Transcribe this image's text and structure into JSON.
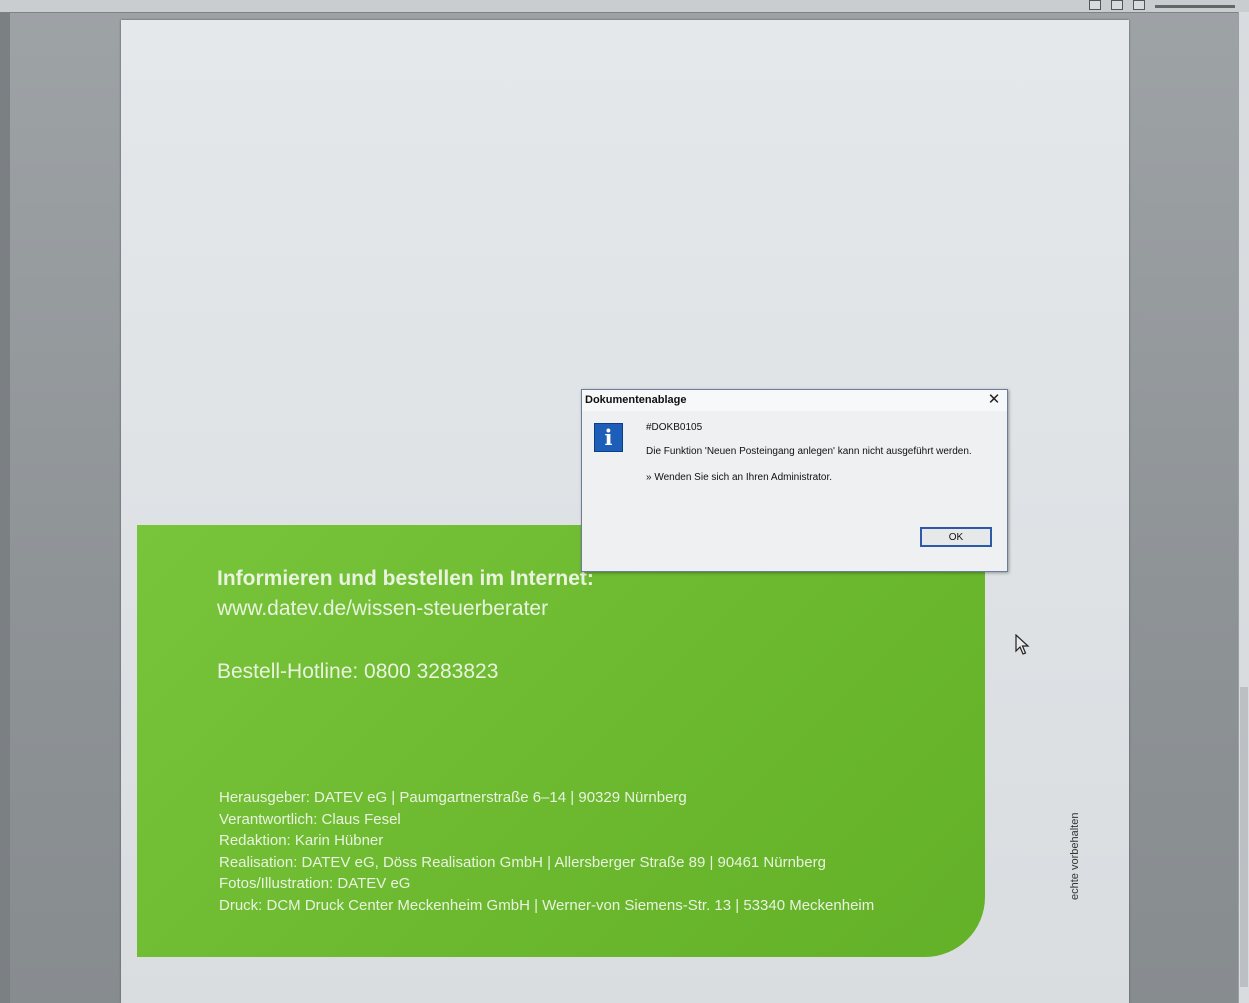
{
  "document": {
    "green_panel": {
      "heading": "Informieren und bestellen im Internet:",
      "url": "www.datev.de/wissen-steuerberater",
      "hotline": "Bestell-Hotline: 0800 3283823",
      "imprint": [
        "Herausgeber: DATEV eG | Paumgartnerstraße 6–14 | 90329 Nürnberg",
        "Verantwortlich: Claus Fesel",
        "Redaktion: Karin Hübner",
        "Realisation: DATEV eG, Döss Realisation GmbH | Allersberger Straße 89 | 90461 Nürnberg",
        "Fotos/Illustration: DATEV eG",
        "Druck: DCM Druck Center Meckenheim GmbH | Werner-von Siemens-Str. 13 | 53340 Meckenheim"
      ]
    },
    "vertical_note": "echte vorbehalten"
  },
  "dialog": {
    "title": "Dokumentenablage",
    "close_symbol": "✕",
    "icon": "info-icon",
    "icon_glyph": "i",
    "code": "#DOKB0105",
    "message": "Die Funktion 'Neuen Posteingang anlegen' kann nicht ausgeführt werden.",
    "hint": "» Wenden Sie sich an Ihren Administrator.",
    "ok_label": "OK"
  },
  "colors": {
    "green_panel": "#6cb92f",
    "dialog_border": "#6b7d99",
    "info_icon": "#1d5fb8",
    "ok_focus": "#2a5aa8"
  }
}
